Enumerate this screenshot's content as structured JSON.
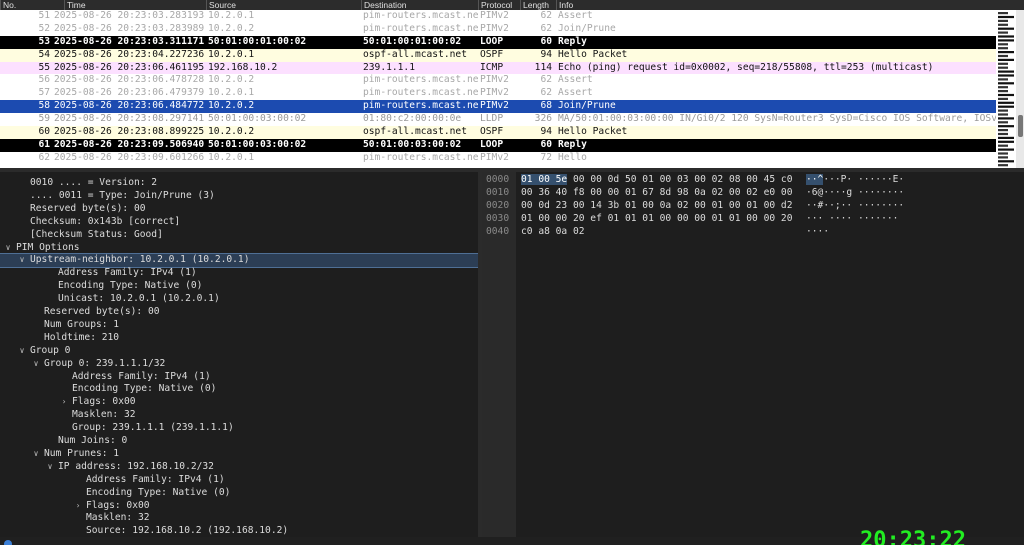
{
  "packet_list": {
    "columns": [
      "No.",
      "Time",
      "Source",
      "Destination",
      "Protocol",
      "Length",
      "Info"
    ],
    "rows": [
      {
        "no": "51",
        "time": "2025-08-26 20:23:03.283193",
        "src": "10.2.0.1",
        "dst": "pim-routers.mcast.net",
        "proto": "PIMv2",
        "len": "62",
        "info": "Assert",
        "style": "gray"
      },
      {
        "no": "52",
        "time": "2025-08-26 20:23:03.283989",
        "src": "10.2.0.2",
        "dst": "pim-routers.mcast.net",
        "proto": "PIMv2",
        "len": "62",
        "info": "Join/Prune",
        "style": "gray"
      },
      {
        "no": "53",
        "time": "2025-08-26 20:23:03.311171",
        "src": "50:01:00:01:00:02",
        "dst": "50:01:00:01:00:02",
        "proto": "LOOP",
        "len": "60",
        "info": "Reply",
        "style": "loop"
      },
      {
        "no": "54",
        "time": "2025-08-26 20:23:04.227236",
        "src": "10.2.0.1",
        "dst": "ospf-all.mcast.net",
        "proto": "OSPF",
        "len": "94",
        "info": "Hello Packet",
        "style": "ospf"
      },
      {
        "no": "55",
        "time": "2025-08-26 20:23:06.461195",
        "src": "192.168.10.2",
        "dst": "239.1.1.1",
        "proto": "ICMP",
        "len": "114",
        "info": "Echo (ping) request  id=0x0002, seq=218/55808, ttl=253 (multicast)",
        "style": "icmp"
      },
      {
        "no": "56",
        "time": "2025-08-26 20:23:06.478728",
        "src": "10.2.0.2",
        "dst": "pim-routers.mcast.net",
        "proto": "PIMv2",
        "len": "62",
        "info": "Assert",
        "style": "gray"
      },
      {
        "no": "57",
        "time": "2025-08-26 20:23:06.479379",
        "src": "10.2.0.1",
        "dst": "pim-routers.mcast.net",
        "proto": "PIMv2",
        "len": "62",
        "info": "Assert",
        "style": "gray"
      },
      {
        "no": "58",
        "time": "2025-08-26 20:23:06.484772",
        "src": "10.2.0.2",
        "dst": "pim-routers.mcast.net",
        "proto": "PIMv2",
        "len": "68",
        "info": "Join/Prune",
        "style": "sel"
      },
      {
        "no": "59",
        "time": "2025-08-26 20:23:08.297141",
        "src": "50:01:00:03:00:02",
        "dst": "01:80:c2:00:00:0e",
        "proto": "LLDP",
        "len": "326",
        "info": "MA/50:01:00:03:00:00 IN/Gi0/2 120 SysN=Router3 SysD=Cisco IOS Software, IOSv S",
        "style": "lldp"
      },
      {
        "no": "60",
        "time": "2025-08-26 20:23:08.899225",
        "src": "10.2.0.2",
        "dst": "ospf-all.mcast.net",
        "proto": "OSPF",
        "len": "94",
        "info": "Hello Packet",
        "style": "ospf"
      },
      {
        "no": "61",
        "time": "2025-08-26 20:23:09.506940",
        "src": "50:01:00:03:00:02",
        "dst": "50:01:00:03:00:02",
        "proto": "LOOP",
        "len": "60",
        "info": "Reply",
        "style": "loop"
      },
      {
        "no": "62",
        "time": "2025-08-26 20:23:09.601266",
        "src": "10.2.0.1",
        "dst": "pim-routers.mcast.net",
        "proto": "PIMv2",
        "len": "72",
        "info": "Hello",
        "style": "gray"
      }
    ]
  },
  "details": {
    "lines": [
      {
        "text": "0010 .... = Version: 2",
        "arrow": ""
      },
      {
        "text": ".... 0011 = Type: Join/Prune (3)",
        "arrow": ""
      },
      {
        "text": "Reserved byte(s): 00",
        "arrow": ""
      },
      {
        "text": "Checksum: 0x143b [correct]",
        "arrow": ""
      },
      {
        "text": "[Checksum Status: Good]",
        "arrow": ""
      },
      {
        "text": "PIM Options",
        "arrow": "down"
      },
      {
        "text": "Upstream-neighbor: 10.2.0.1 (10.2.0.1)",
        "arrow": "down",
        "selected": true
      },
      {
        "text": "Address Family: IPv4 (1)",
        "arrow": ""
      },
      {
        "text": "Encoding Type: Native (0)",
        "arrow": ""
      },
      {
        "text": "Unicast: 10.2.0.1 (10.2.0.1)",
        "arrow": ""
      },
      {
        "text": "Reserved byte(s): 00",
        "arrow": ""
      },
      {
        "text": "Num Groups: 1",
        "arrow": ""
      },
      {
        "text": "Holdtime: 210",
        "arrow": ""
      },
      {
        "text": "Group 0",
        "arrow": "down"
      },
      {
        "text": "Group 0: 239.1.1.1/32",
        "arrow": "down"
      },
      {
        "text": "Address Family: IPv4 (1)",
        "arrow": ""
      },
      {
        "text": "Encoding Type: Native (0)",
        "arrow": ""
      },
      {
        "text": "Flags: 0x00",
        "arrow": "right"
      },
      {
        "text": "Masklen: 32",
        "arrow": ""
      },
      {
        "text": "Group: 239.1.1.1 (239.1.1.1)",
        "arrow": ""
      },
      {
        "text": "Num Joins: 0",
        "arrow": ""
      },
      {
        "text": "Num Prunes: 1",
        "arrow": "down"
      },
      {
        "text": "IP address: 192.168.10.2/32",
        "arrow": "down"
      },
      {
        "text": "Address Family: IPv4 (1)",
        "arrow": ""
      },
      {
        "text": "Encoding Type: Native (0)",
        "arrow": ""
      },
      {
        "text": "Flags: 0x00",
        "arrow": "right"
      },
      {
        "text": "Masklen: 32",
        "arrow": ""
      },
      {
        "text": "Source: 192.168.10.2 (192.168.10.2)",
        "arrow": ""
      }
    ]
  },
  "bytes": {
    "lines": [
      {
        "offset": "0000",
        "hex_hl": "01 00 5e",
        "hex": " 00 00 0d 50 01  00 03 00 02 08 00 45 c0",
        "ascii_hl": "··^",
        "ascii": "···P· ······E·"
      },
      {
        "offset": "0010",
        "hex_hl": "",
        "hex": "00 36 40 f8 00 00 01 67  8d 98 0a 02 00 02 e0 00",
        "ascii_hl": "",
        "ascii": "·6@····g ········"
      },
      {
        "offset": "0020",
        "hex_hl": "",
        "hex": "00 0d 23 00 14 3b 01 00  0a 02 00 01 00 01 00 d2",
        "ascii_hl": "",
        "ascii": "··#··;·· ········"
      },
      {
        "offset": "0030",
        "hex_hl": "",
        "hex": "01 00 00 20 ef 01 01 01  00 00 00 01 01 00 00 20",
        "ascii_hl": "",
        "ascii": "··· ···· ······· "
      },
      {
        "offset": "0040",
        "hex_hl": "",
        "hex": "c0 a8 0a 02",
        "ascii_hl": "",
        "ascii": "····"
      }
    ]
  },
  "status": {
    "clock": "20:23:22"
  },
  "colors": {
    "selected_row": "#1c4bb0",
    "loop_row": "#000000",
    "ospf_row": "#fffde0",
    "icmp_row": "#fce0ff",
    "clock": "#22ee22"
  }
}
